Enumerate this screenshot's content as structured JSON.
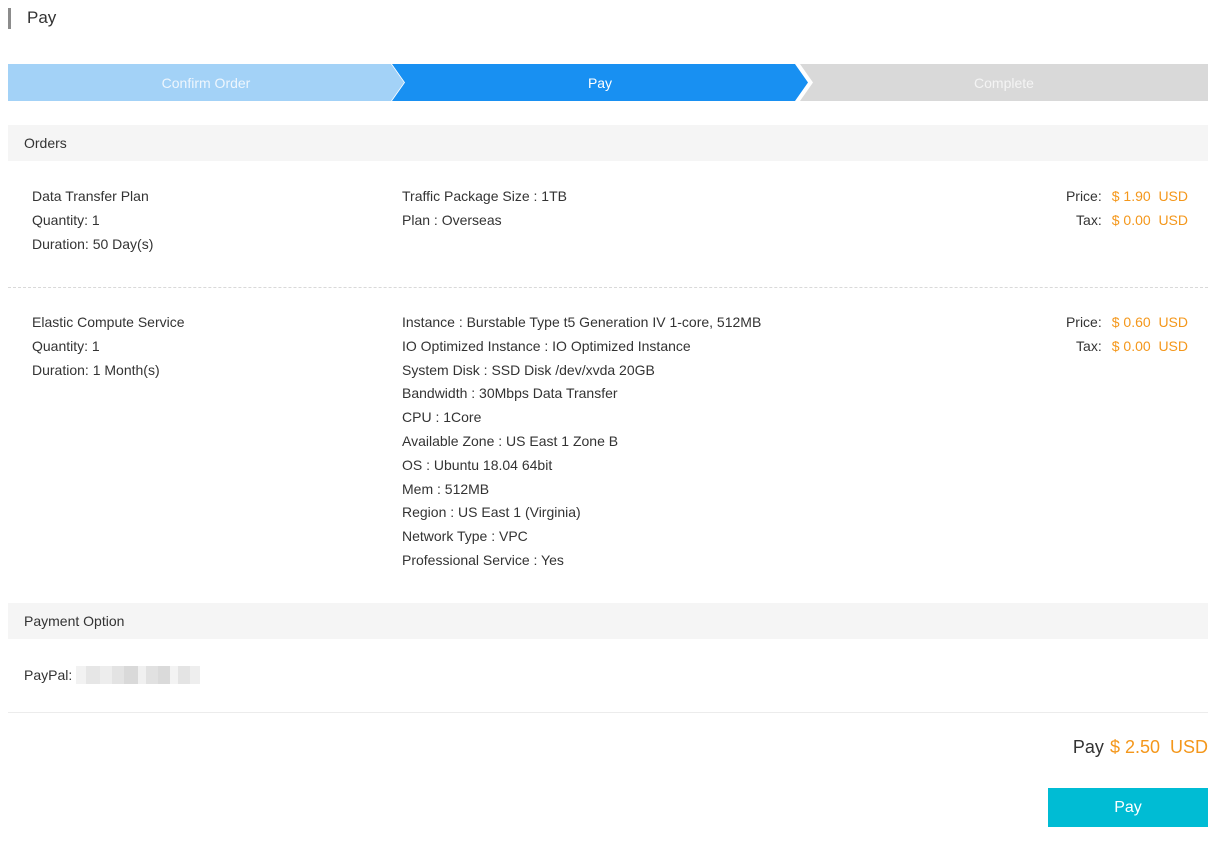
{
  "page_title": "Pay",
  "steps": [
    {
      "label": "Confirm Order",
      "state": "done"
    },
    {
      "label": "Pay",
      "state": "active"
    },
    {
      "label": "Complete",
      "state": "pending"
    }
  ],
  "orders_heading": "Orders",
  "orders": [
    {
      "product": "Data Transfer Plan",
      "quantity": "Quantity: 1",
      "duration": "Duration: 50 Day(s)",
      "specs": [
        "Traffic Package Size : 1TB",
        "Plan : Overseas"
      ],
      "price_label": "Price:",
      "price": "$ 1.90  USD",
      "tax_label": "Tax:",
      "tax": "$ 0.00  USD"
    },
    {
      "product": "Elastic Compute Service",
      "quantity": "Quantity: 1",
      "duration": "Duration: 1 Month(s)",
      "specs": [
        "Instance : Burstable Type t5 Generation IV 1-core, 512MB",
        "IO Optimized Instance : IO Optimized Instance",
        "System Disk : SSD Disk /dev/xvda 20GB",
        "Bandwidth : 30Mbps Data Transfer",
        "CPU : 1Core",
        "Available Zone : US East 1 Zone B",
        "OS : Ubuntu 18.04 64bit",
        "Mem : 512MB",
        "Region : US East 1 (Virginia)",
        "Network Type : VPC",
        "Professional Service : Yes"
      ],
      "price_label": "Price:",
      "price": "$ 0.60  USD",
      "tax_label": "Tax:",
      "tax": "$ 0.00  USD"
    }
  ],
  "payment_heading": "Payment Option",
  "payment": {
    "label": "PayPal:"
  },
  "total": {
    "label": "Pay",
    "amount": "$ 2.50  USD"
  },
  "pay_button": "Pay",
  "colors": {
    "accent": "#1890f2",
    "step_done": "#a3d2f7",
    "step_pending": "#d9d9d9",
    "price": "#f4971b",
    "pay_button": "#00bcd4"
  }
}
